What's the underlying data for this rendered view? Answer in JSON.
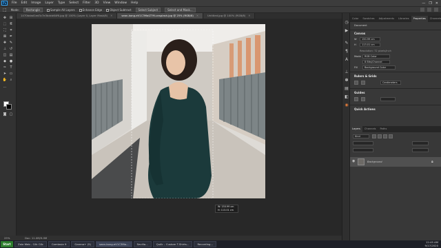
{
  "menubar": {
    "logo": "Ps",
    "items": [
      "File",
      "Edit",
      "Image",
      "Layer",
      "Type",
      "Select",
      "Filter",
      "3D",
      "View",
      "Window",
      "Help"
    ],
    "window_controls": [
      "—",
      "❐",
      "✕"
    ]
  },
  "options_bar": {
    "mode_label": "Mode:",
    "mode_value": "Rectangle",
    "sample_all_layers": "Sample All Layers",
    "enhance_edge": "Enhance Edge",
    "object_subtract": "Object Subtract",
    "select_subject": "Select Subject",
    "select_and_mask": "Select and Mask..."
  },
  "tabs": [
    {
      "label": "1470bdad1ed3c7e3bdcb64f6.jpg @ 100% (Layer 0, Layer Mask/8)",
      "active": false
    },
    {
      "label": "sean-kong-eV1C3MaiZ7M-unsplash.jpg @ 25% (RGB/8)",
      "active": true
    },
    {
      "label": "Untitled.jpg @ 100% (RGB/8)",
      "active": false
    }
  ],
  "status": {
    "zoom": "25%",
    "size": "Doc: 11.0M/9.0M"
  },
  "tooltip": {
    "w": "W: 150.99 cm",
    "h": "H: 113.01 cm"
  },
  "panel_tabs_top": [
    "Color",
    "Swatches",
    "Adjustments",
    "Libraries",
    "Properties",
    "Channels"
  ],
  "properties": {
    "doc_label": "Document",
    "canvas_heading": "Canvas",
    "w": "150.99 cm",
    "h": "113.01 cm",
    "resolution": "Resolution: 72 pixels/inch",
    "mode_label": "Mode",
    "mode_value": "RGB Color",
    "depth_value": "8 Bits/Channel",
    "fill_label": "Fill",
    "fill_value": "Background Color",
    "rulers_heading": "Rulers & Grids",
    "ruler_unit": "Centimeters",
    "guides_heading": "Guides",
    "quick_actions_heading": "Quick Actions"
  },
  "layers_panel": {
    "tabs": [
      "Layers",
      "Channels",
      "Paths"
    ],
    "kind_label": "Kind",
    "layer_name": "Background"
  },
  "taskbar": {
    "start_label": "Start",
    "tasks": [
      {
        "label": "Zalo Web - Cốc Cốc",
        "active": false
      },
      {
        "label": "Camtasia 9",
        "active": false
      },
      {
        "label": "Garena+ (5)",
        "active": false
      },
      {
        "label": "sean-kong-eV1C3Ma...",
        "active": true
      },
      {
        "label": "Sevilla...",
        "active": false
      },
      {
        "label": "Quốc – Custom T-Shirts...",
        "active": false
      },
      {
        "label": "Recording...",
        "active": false
      }
    ],
    "time": "12:45 AM",
    "date": "9/17/2020"
  }
}
